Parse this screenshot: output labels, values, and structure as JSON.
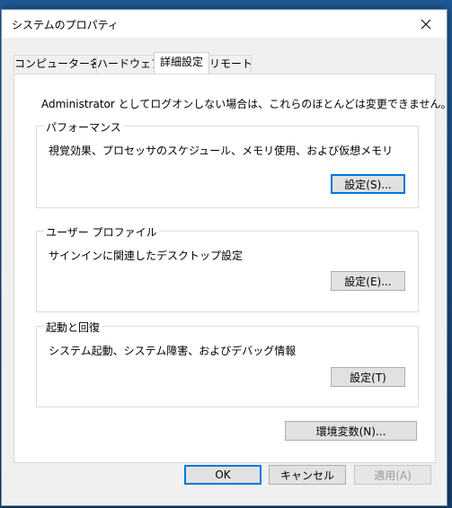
{
  "window": {
    "title": "システムのプロパティ"
  },
  "tabs": [
    {
      "label": "コンピューター名"
    },
    {
      "label": "ハードウェア"
    },
    {
      "label": "詳細設定"
    },
    {
      "label": "リモート"
    }
  ],
  "admin_note": "Administrator としてログオンしない場合は、これらのほとんどは変更できません。",
  "groups": {
    "performance": {
      "title": "パフォーマンス",
      "description": "視覚効果、プロセッサのスケジュール、メモリ使用、および仮想メモリ",
      "button": "設定(S)..."
    },
    "user_profile": {
      "title": "ユーザー プロファイル",
      "description": "サインインに関連したデスクトップ設定",
      "button": "設定(E)..."
    },
    "startup": {
      "title": "起動と回復",
      "description": "システム起動、システム障害、およびデバッグ情報",
      "button": "設定(T)"
    }
  },
  "env_button": "環境変数(N)...",
  "footer": {
    "ok": "OK",
    "cancel": "キャンセル",
    "apply": "適用(A)"
  },
  "colors": {
    "accent": "#0078d7",
    "window_bg": "#f0f0f0",
    "panel_bg": "#ffffff",
    "button_bg": "#e1e1e1",
    "disabled_text": "#9a9a9a"
  },
  "icons": {
    "close": "close-icon"
  }
}
